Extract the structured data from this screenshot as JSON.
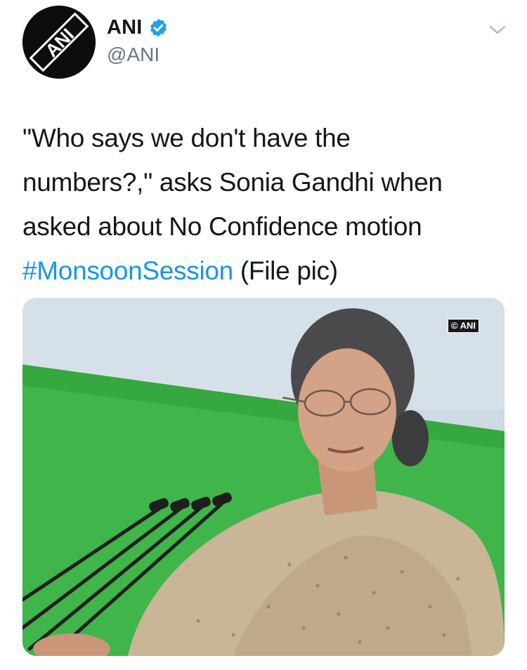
{
  "tweet": {
    "author": {
      "display_name": "ANI",
      "handle": "@ANI",
      "verified": true,
      "avatar_icon": "ani-logo",
      "avatar_text": "ANI"
    },
    "text_lines": [
      "\"Who says we don't have the",
      "numbers?,\" asks Sonia Gandhi when",
      "asked about No Confidence motion"
    ],
    "hashtag": "#MonsoonSession",
    "trailing_text": " (File pic)",
    "media": {
      "watermark": "© ANI"
    }
  },
  "colors": {
    "link": "#1b95e0",
    "verified": "#1da1f2",
    "secondary_text": "#657786",
    "primary_text": "#14171a"
  }
}
